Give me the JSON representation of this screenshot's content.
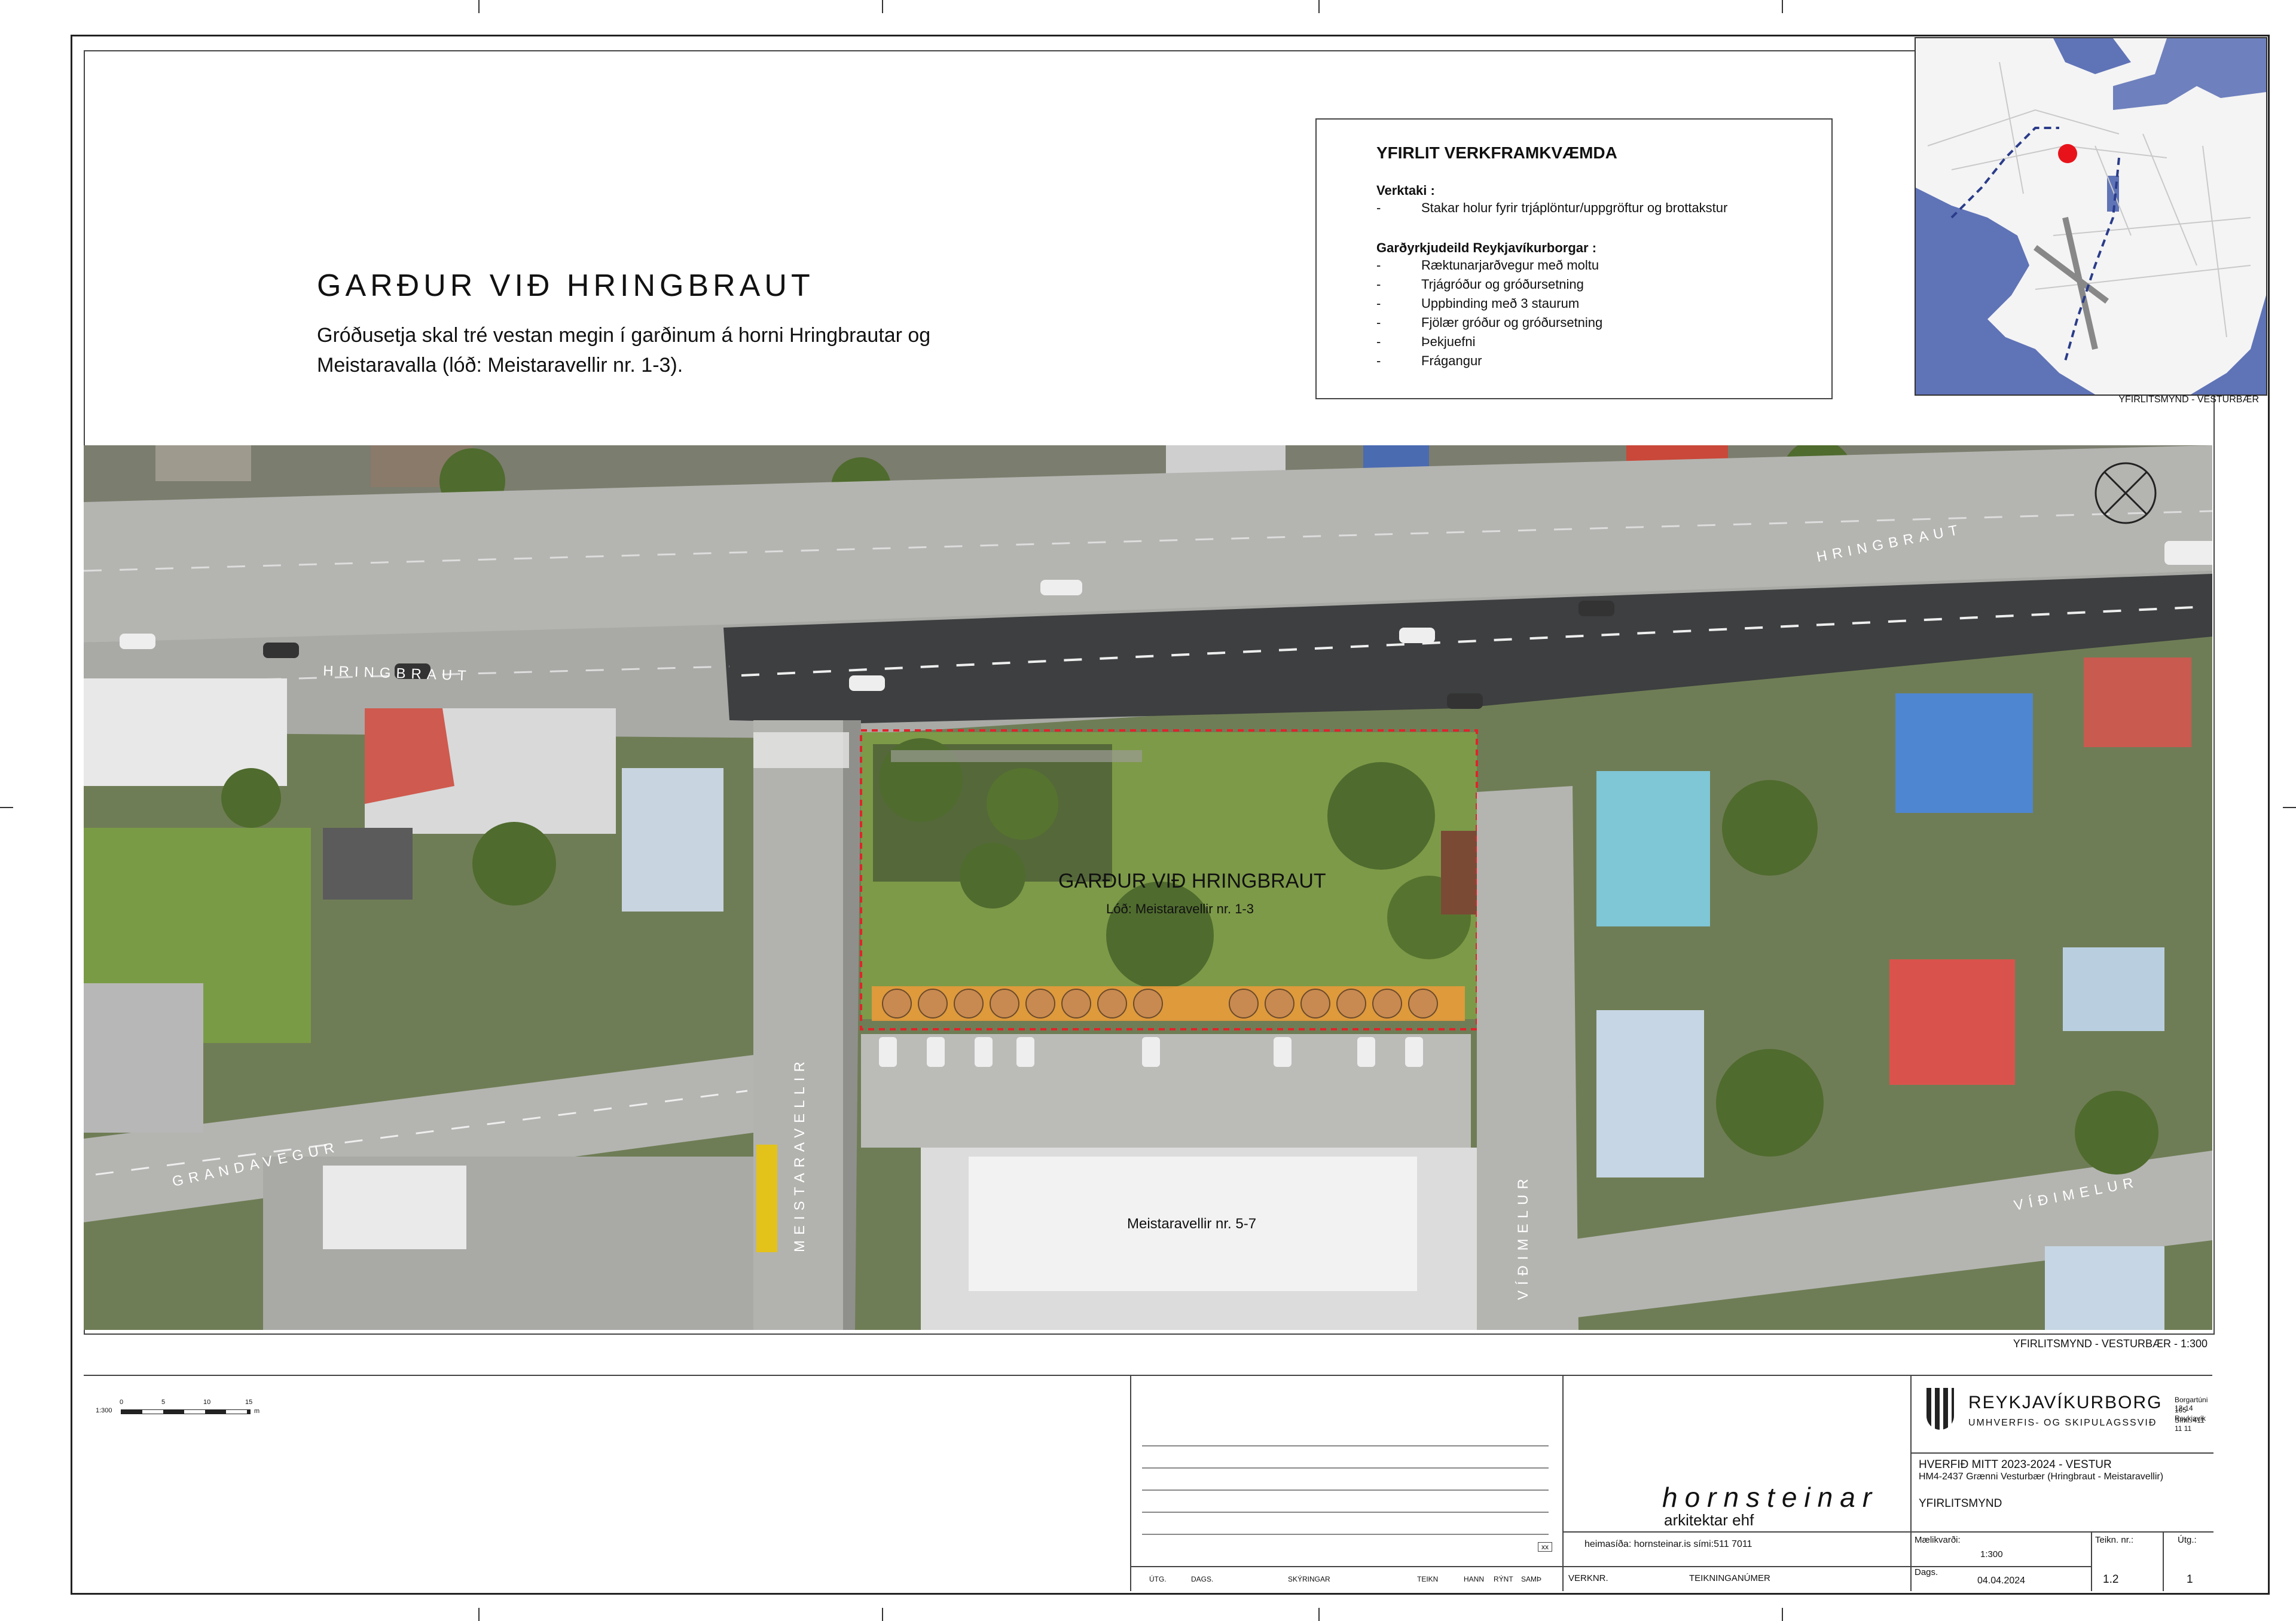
{
  "title": "GARÐUR VIÐ HRINGBRAUT",
  "subtitle": "Gróðusetja skal tré vestan megin í garðinum á horni Hringbrautar og Meistaravalla (lóð: Meistaravellir nr. 1-3).",
  "yfirlit": {
    "heading": "YFIRLIT VERKFRAMKVÆMDA",
    "contractor_label": "Verktaki :",
    "contractor_items": [
      "Stakar holur fyrir trjáplöntur/uppgröftur og brottakstur"
    ],
    "city_label": "Garðyrkjudeild Reykjavíkurborgar :",
    "city_items": [
      "Ræktunarjarðvegur með moltu",
      "Trjágróður og gróðursetning",
      "Uppbinding með 3 staurum",
      "Fjölær gróður og gróðursetning",
      "Þekjuefni",
      "Frágangur"
    ]
  },
  "locator_caption": "YFIRLITSMYND - VESTURBÆR",
  "aerial": {
    "streets": {
      "hringbraut_west": "HRINGBRAUT",
      "hringbraut_east": "HRINGBRAUT",
      "grandavegur": "GRANDAVEGUR",
      "meistaravellir": "MEISTARAVELLIR",
      "vidimelur_north": "VÍÐIMELUR",
      "vidimelur_east": "VÍÐIMELUR"
    },
    "site_title": "GARÐUR VIÐ HRINGBRAUT",
    "site_lot": "Lóð: Meistaravellir nr. 1-3",
    "building_label": "Meistaravellir nr. 5-7",
    "caption": "YFIRLITSMYND - VESTURBÆR - 1:300"
  },
  "scale_bar": {
    "label": "1:300",
    "ticks": [
      "0",
      "5",
      "10",
      "15"
    ],
    "unit": "m"
  },
  "revision": {
    "xx": "xx",
    "cols": [
      "ÚTG.",
      "DAGS.",
      "SKÝRINGAR",
      "TEIKN",
      "HANN",
      "RÝNT",
      "SAMÞ"
    ]
  },
  "architect": {
    "name": "hornsteinar",
    "sub": "arkitektar ehf",
    "contact": "heimasíða: hornsteinar.is   sími:511 7011",
    "verknr": "VERKNR.",
    "teikn": "TEIKNINGANÚMER"
  },
  "client": {
    "name": "REYKJAVÍKURBORG",
    "dept": "UMHVERFIS- OG SKIPULAGSSVIÐ",
    "address1": "Borgartúni 12-14",
    "address2": "105 Reykjavík",
    "phone": "Sími: 411 11 11",
    "project": "HVERFIÐ MITT 2023-2024 - VESTUR",
    "project_sub": "HM4-2437 Grænni Vesturbær (Hringbraut - Meistaravellir)",
    "sheet_title": "YFIRLITSMYND",
    "scale_label": "Mælikvarði:",
    "scale": "1:300",
    "sheet_no_label": "Teikn. nr.:",
    "sheet_no": "1.2",
    "edition_label": "Útg.:",
    "edition": "1",
    "date_label": "Dags.",
    "date": "04.04.2024"
  },
  "colors": {
    "road": "#a9aaa6",
    "road_dark": "#3d3f40",
    "grass": "#7c9a45",
    "tree": "#4f6b2e",
    "site_border": "#e0242a",
    "tree_strip": "#e99a3a",
    "water": "#5f73b7"
  }
}
